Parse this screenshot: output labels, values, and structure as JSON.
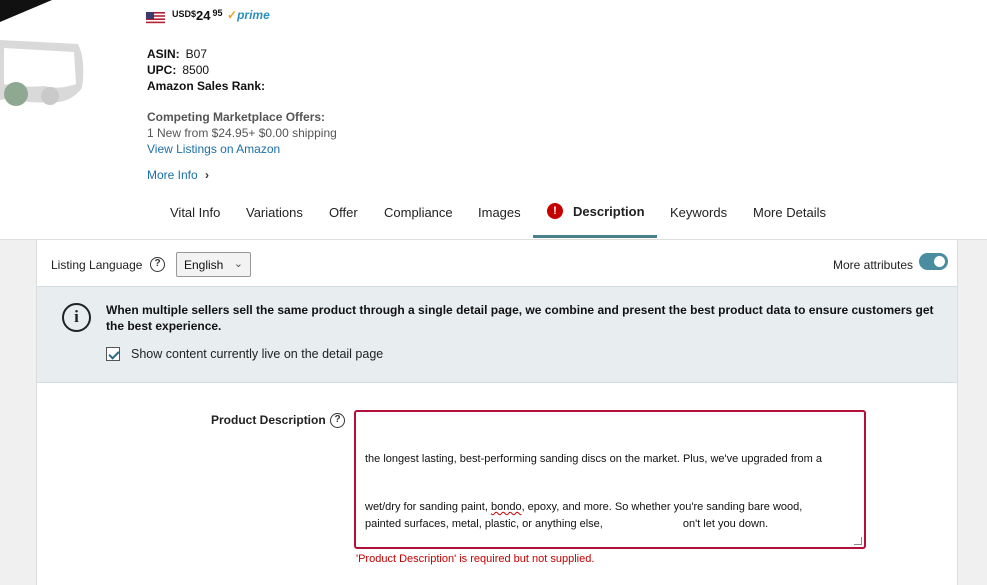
{
  "product": {
    "price_currency": "USD$",
    "price_whole": "24",
    "price_cents": "95",
    "prime_label": "prime",
    "asin_label": "ASIN:",
    "asin_value": "B07",
    "upc_label": "UPC:",
    "upc_value": "8500",
    "sales_rank_label": "Amazon Sales Rank:",
    "competing_label": "Competing Marketplace Offers:",
    "offers_text": "1 New  from $24.95+ $0.00 shipping",
    "view_listings_link": "View Listings on Amazon",
    "more_info_link": "More Info",
    "more_info_chevron": ">"
  },
  "tabs": [
    {
      "label": "Vital Info"
    },
    {
      "label": "Variations"
    },
    {
      "label": "Offer"
    },
    {
      "label": "Compliance"
    },
    {
      "label": "Images"
    },
    {
      "label": "Description",
      "active": true,
      "error": true
    },
    {
      "label": "Keywords"
    },
    {
      "label": "More Details"
    }
  ],
  "error_badge": "!",
  "listing": {
    "language_label": "Listing Language",
    "help_glyph": "?",
    "language_value": "English",
    "more_attributes_label": "More attributes",
    "more_attributes_on": true
  },
  "banner": {
    "icon": "i",
    "text": "When multiple sellers sell the same product through a single detail page, we combine and present the best product data to ensure customers get the best experience.",
    "checkbox_label": "Show content currently live on the detail page",
    "checked": true
  },
  "description": {
    "label": "Product Description",
    "line1": "the longest lasting, best-performing sanding discs on the market. Plus, we've upgraded from a",
    "line2_a": "wet/dry for sanding paint, ",
    "line2_err": "bondo",
    "line2_b": ", epoxy, and more. So whether you're sanding bare wood,",
    "line3_a": "painted surfaces, metal, plastic, or anything else,",
    "line3_b": "on't let you down.",
    "error_message": "'Product Description' is required but not supplied."
  },
  "colors": {
    "accent": "#4a7f8c",
    "error": "#c40000",
    "link": "#1b6fa8",
    "prime": "#2a8fbd"
  }
}
